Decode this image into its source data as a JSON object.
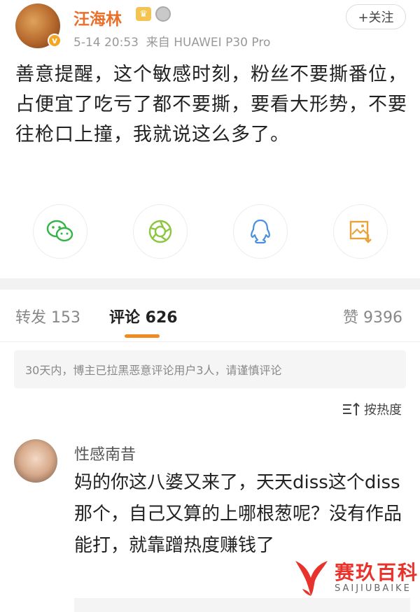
{
  "header": {
    "username": "汪海林",
    "timestamp": "5-14 20:53",
    "source": "来自 HUAWEI P30 Pro",
    "follow_label": "+关注",
    "verified_mark": "v"
  },
  "post": {
    "text": "善意提醒，这个敏感时刻，粉丝不要撕番位，占便宜了吃亏了都不要撕，要看大形势，不要往枪口上撞，我就说这么多了。"
  },
  "share_icons": [
    "wechat-icon",
    "moments-icon",
    "qq-icon",
    "save-image-icon"
  ],
  "tabs": {
    "repost": "转发 153",
    "comments": "评论 626",
    "likes": "赞 9396"
  },
  "notice": "30天内，博主已拉黑恶意评论用户3人，请谨慎评论",
  "sort_label": "按热度",
  "comment": {
    "name": "性感南昔",
    "text": "妈的你这八婆又来了，天天diss这个diss那个，自己又算的上哪根葱呢？没有作品能打，就靠蹭热度赚钱了"
  },
  "watermark": {
    "title": "赛玖百科",
    "subtitle": "SAIJIUBAIKE"
  },
  "colors": {
    "username": "#e8702a",
    "accent_tab": "#f08c1e",
    "wechat": "#34b348",
    "moments": "#8cc63f",
    "qq": "#4a90e2",
    "save": "#e8a33a",
    "watermark": "#e8332c"
  }
}
